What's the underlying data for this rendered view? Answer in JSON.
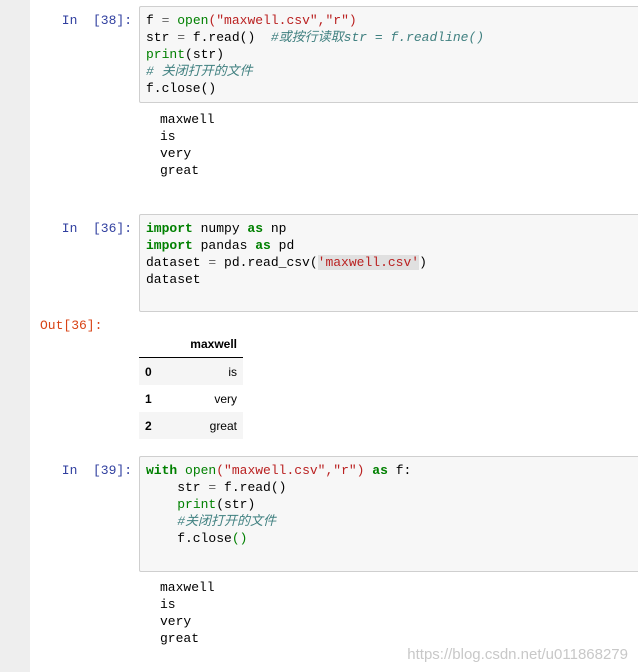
{
  "cells": [
    {
      "prompt": "In  [38]:",
      "code_lines": [
        [
          {
            "t": "f "
          },
          {
            "t": "=",
            "c": "op"
          },
          {
            "t": " "
          },
          {
            "t": "open",
            "c": "bi"
          },
          {
            "t": "(\"maxwell.csv\",\"r\")",
            "c": "str"
          }
        ],
        [
          {
            "t": "str "
          },
          {
            "t": "=",
            "c": "op"
          },
          {
            "t": " f.read()  "
          },
          {
            "t": "#或按行读取str = f.readline()",
            "c": "cm"
          }
        ],
        [
          {
            "t": "print",
            "c": "bi"
          },
          {
            "t": "(str)"
          }
        ],
        [
          {
            "t": "# 关闭打开的文件",
            "c": "cm"
          }
        ],
        [
          {
            "t": "f.close()"
          }
        ]
      ],
      "output": [
        "maxwell",
        "is",
        "very",
        "great"
      ]
    },
    {
      "prompt": "In  [36]:",
      "code_lines": [
        [
          {
            "t": "import",
            "c": "kw"
          },
          {
            "t": " numpy "
          },
          {
            "t": "as",
            "c": "kw"
          },
          {
            "t": " np"
          }
        ],
        [
          {
            "t": "import",
            "c": "kw"
          },
          {
            "t": " pandas "
          },
          {
            "t": "as",
            "c": "kw"
          },
          {
            "t": " pd"
          }
        ],
        [
          {
            "t": "dataset "
          },
          {
            "t": "=",
            "c": "op"
          },
          {
            "t": " pd.read_csv("
          },
          {
            "t": "'maxwell.csv'",
            "c": "str hl"
          },
          {
            "t": ")"
          }
        ],
        [
          {
            "t": "dataset"
          }
        ]
      ],
      "out_prompt": "Out[36]:",
      "table": {
        "columns": [
          "",
          "maxwell"
        ],
        "rows": [
          [
            "0",
            "is"
          ],
          [
            "1",
            "very"
          ],
          [
            "2",
            "great"
          ]
        ]
      }
    },
    {
      "prompt": "In  [39]:",
      "code_lines": [
        [
          {
            "t": "with",
            "c": "kw"
          },
          {
            "t": " "
          },
          {
            "t": "open",
            "c": "bi"
          },
          {
            "t": "(\"maxwell.csv\",\"r\")",
            "c": "str"
          },
          {
            "t": " "
          },
          {
            "t": "as",
            "c": "kw"
          },
          {
            "t": " f:"
          }
        ],
        [
          {
            "t": "    str "
          },
          {
            "t": "=",
            "c": "op"
          },
          {
            "t": " f.read()"
          }
        ],
        [
          {
            "t": "    "
          },
          {
            "t": "print",
            "c": "bi"
          },
          {
            "t": "(str)"
          }
        ],
        [
          {
            "t": "    "
          },
          {
            "t": "#关闭打开的文件",
            "c": "cm"
          }
        ],
        [
          {
            "t": "    f.close"
          },
          {
            "t": "()",
            "c": "bi"
          }
        ]
      ],
      "output": [
        "maxwell",
        "is",
        "very",
        "great"
      ]
    }
  ],
  "watermark": "https://blog.csdn.net/u011868279"
}
